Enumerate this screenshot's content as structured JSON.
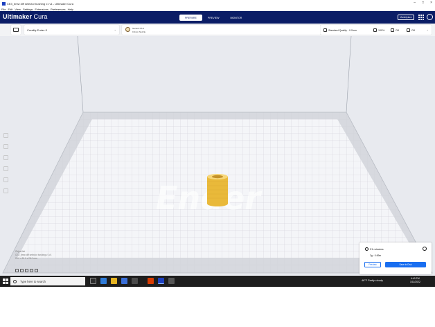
{
  "window": {
    "title": "CE3_bmw diff selector bushing v1 v1 - Ultimaker Cura",
    "controls": [
      "–",
      "□",
      "×"
    ]
  },
  "menu": [
    "File",
    "Edit",
    "View",
    "Settings",
    "Extensions",
    "Preferences",
    "Help"
  ],
  "header": {
    "brand_strong": "Ultimaker",
    "brand_light": " Cura",
    "stages": [
      {
        "label": "PREPARE",
        "active": true
      },
      {
        "label": "PREVIEW",
        "active": false
      },
      {
        "label": "MONITOR",
        "active": false
      }
    ],
    "marketplace_label": "Marketplace"
  },
  "toolbar": {
    "printer_name": "Creality Ender-3",
    "material_line1": "Generic PLA",
    "material_line2": "0.4mm Nozzle",
    "quality_label": "Standard Quality - 0.2mm",
    "infill_label": "100%",
    "support_label": "Off",
    "adhesion_label": "Off"
  },
  "object_list": {
    "heading": "Object list",
    "file_name": "CE3_bmw diff selector bushing v1 v1",
    "dimensions": "20.0 x 20.0 x 28.0 mm"
  },
  "action_panel": {
    "print_time": "21 minutes",
    "material_amount": "2g · 0.69m",
    "preview_label": "Preview",
    "save_label": "Save to Disk"
  },
  "taskbar": {
    "search_placeholder": "Type here to search",
    "weather": "46°F  Partly cloudy",
    "time": "4:40 PM",
    "date": "1/11/2022"
  },
  "colors": {
    "header_bg": "#0b1d66",
    "accent": "#196ef0",
    "model": "#f2c84b"
  },
  "icons": [
    "folder-icon",
    "printer-icon",
    "clock-icon",
    "info-icon",
    "search-icon",
    "windows-icon",
    "grid-icon",
    "account-icon"
  ]
}
